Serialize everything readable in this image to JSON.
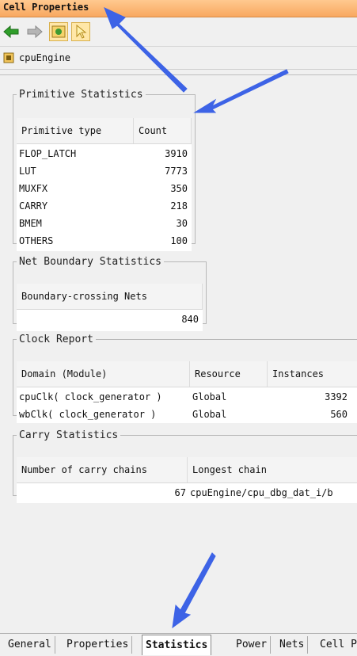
{
  "window": {
    "title": "Cell Properties"
  },
  "toolbar": {
    "buttons": [
      "back-arrow",
      "forward-arrow",
      "refresh-schematic",
      "select-pointer"
    ]
  },
  "breadcrumb": {
    "cell_name": "cpuEngine"
  },
  "primitive_stats": {
    "legend": "Primitive Statistics",
    "headers": [
      "Primitive type",
      "Count"
    ],
    "rows": [
      [
        "FLOP_LATCH",
        "3910"
      ],
      [
        "LUT",
        "7773"
      ],
      [
        "MUXFX",
        "350"
      ],
      [
        "CARRY",
        "218"
      ],
      [
        "BMEM",
        "30"
      ],
      [
        "OTHERS",
        "100"
      ]
    ]
  },
  "net_boundary": {
    "legend": "Net Boundary Statistics",
    "header": "Boundary-crossing Nets",
    "value": "840"
  },
  "clock_report": {
    "legend": "Clock Report",
    "headers": [
      "Domain (Module)",
      "Resource",
      "Instances"
    ],
    "rows": [
      [
        "cpuClk( clock_generator )",
        "Global",
        "3392"
      ],
      [
        "wbClk( clock_generator )",
        "Global",
        "560"
      ]
    ]
  },
  "carry_stats": {
    "legend": "Carry Statistics",
    "headers": [
      "Number of carry chains",
      "Longest chain"
    ],
    "row": [
      "67",
      "cpuEngine/cpu_dbg_dat_i/b"
    ]
  },
  "tabs": {
    "items": [
      "General",
      "Properties",
      "Statistics",
      "Power",
      "Nets",
      "Cell P"
    ],
    "active": "Statistics"
  },
  "colors": {
    "titlebar": "#f8a860",
    "annotation_arrow": "#3d63e6"
  }
}
